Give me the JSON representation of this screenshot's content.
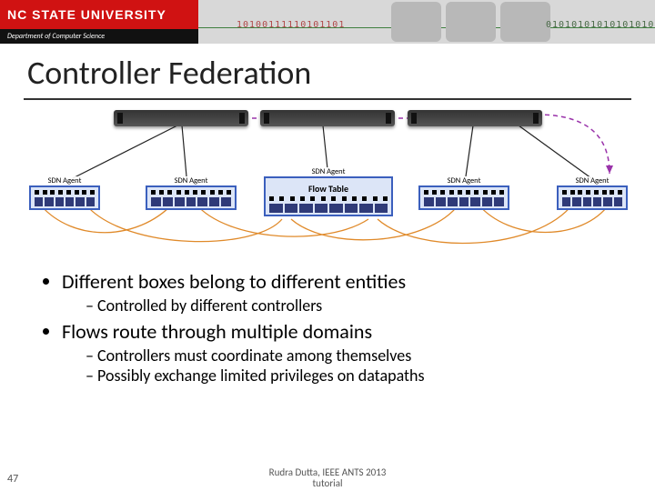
{
  "banner": {
    "university": "NC STATE UNIVERSITY",
    "department": "Department of Computer Science",
    "binary_left": "10100111110101101",
    "binary_right": "01010101010101010"
  },
  "title": "Controller Federation",
  "diagram": {
    "sdn_agent_label": "SDN Agent",
    "flow_table_label": "Flow Table"
  },
  "bullets": {
    "b1": "Different boxes belong to different entities",
    "b1_sub1": "Controlled by different controllers",
    "b2": "Flows route through multiple domains",
    "b2_sub1": "Controllers must coordinate among themselves",
    "b2_sub2": "Possibly exchange limited privileges on datapaths"
  },
  "footer": {
    "citation_line1": "Rudra Dutta, IEEE ANTS 2013",
    "citation_line2": "tutorial"
  },
  "page_number": "47"
}
